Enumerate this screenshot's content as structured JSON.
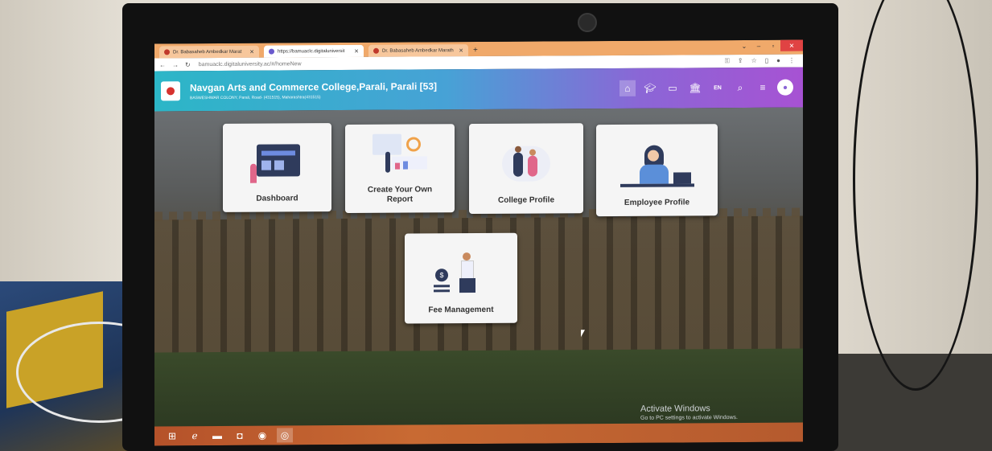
{
  "browser": {
    "tabs": [
      {
        "label": "Dr. Babasaheb Ambedkar Marat",
        "active": false
      },
      {
        "label": "https://bamuaclc.digitaluniversit",
        "active": true
      },
      {
        "label": "Dr. Babasaheb Ambedkar Marath",
        "active": false
      }
    ],
    "new_tab_label": "+",
    "url": "bamuaclc.digitaluniversity.ac/#/homeNew"
  },
  "header": {
    "college_name": "Navgan Arts and Commerce College,Parali, Parali [53]",
    "address": "BASWESHWAR COLONY, Parali, Road- (431515), Maharashtra(431515)",
    "lang_label": "EN"
  },
  "tiles": [
    {
      "label": "Dashboard"
    },
    {
      "label": "Create Your Own Report"
    },
    {
      "label": "College Profile"
    },
    {
      "label": "Employee Profile"
    },
    {
      "label": "Fee Management"
    }
  ],
  "watermark": {
    "title": "Activate Windows",
    "subtitle": "Go to PC settings to activate Windows."
  },
  "colors": {
    "header_start": "#2cb6c7",
    "header_end": "#a752d3",
    "taskbar": "#c86a33"
  }
}
